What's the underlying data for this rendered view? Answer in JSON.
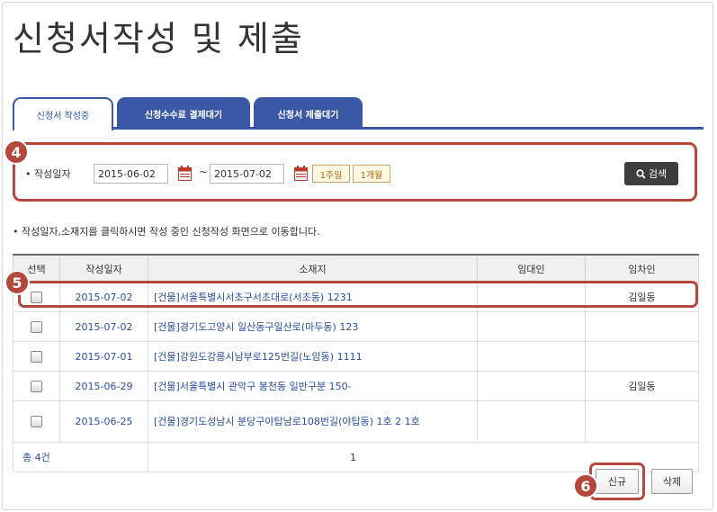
{
  "page": {
    "title": "신청서작성 및 제출"
  },
  "tabs": [
    {
      "label": "신청서 작성중",
      "active": true
    },
    {
      "label": "신청수수료 결제대기",
      "active": false
    },
    {
      "label": "신청서 제출대기",
      "active": false
    }
  ],
  "annotations": {
    "step_search": "4",
    "step_row": "5",
    "step_new": "6"
  },
  "search": {
    "label": "작성일자",
    "start_date": "2015-06-02",
    "separator": "~",
    "end_date": "2015-07-02",
    "one_week": "1주일",
    "one_month": "1개월",
    "search_button": "검색"
  },
  "notice": "작성일자,소재지를 클릭하시면 작성 중인 신청작성 화면으로 이동합니다.",
  "table": {
    "headers": {
      "select": "선택",
      "date": "작성일자",
      "address": "소재지",
      "lessor": "임대인",
      "lessee": "임차인"
    },
    "rows": [
      {
        "date": "2015-07-02",
        "address": "[건물]서울특별시서초구서초대로(서초동) 1231",
        "lessor": "",
        "lessee": "김일동"
      },
      {
        "date": "2015-07-02",
        "address": "[건물]경기도고양시 일산동구일산로(마두동) 123",
        "lessor": "",
        "lessee": ""
      },
      {
        "date": "2015-07-01",
        "address": "[건물]강원도강릉시남부로125번길(노암동) 1111",
        "lessor": "",
        "lessee": ""
      },
      {
        "date": "2015-06-29",
        "address": "[건물]서울특별시 관악구 봉천동 일반구분 150-",
        "lessor": "",
        "lessee": "김일동"
      },
      {
        "date": "2015-06-25",
        "address": "[건물]경기도성남시 분당구야탑남로108번길(야탑동) 1호 2 1호",
        "lessor": "",
        "lessee": ""
      }
    ],
    "total": "총 4건",
    "page": "1"
  },
  "actions": {
    "new_label": "신규",
    "delete_label": "삭제"
  },
  "colors": {
    "primary": "#3b58a6",
    "annotation": "#b5473c",
    "link": "#2b4ea0",
    "dark_button": "#3d3d3d"
  }
}
